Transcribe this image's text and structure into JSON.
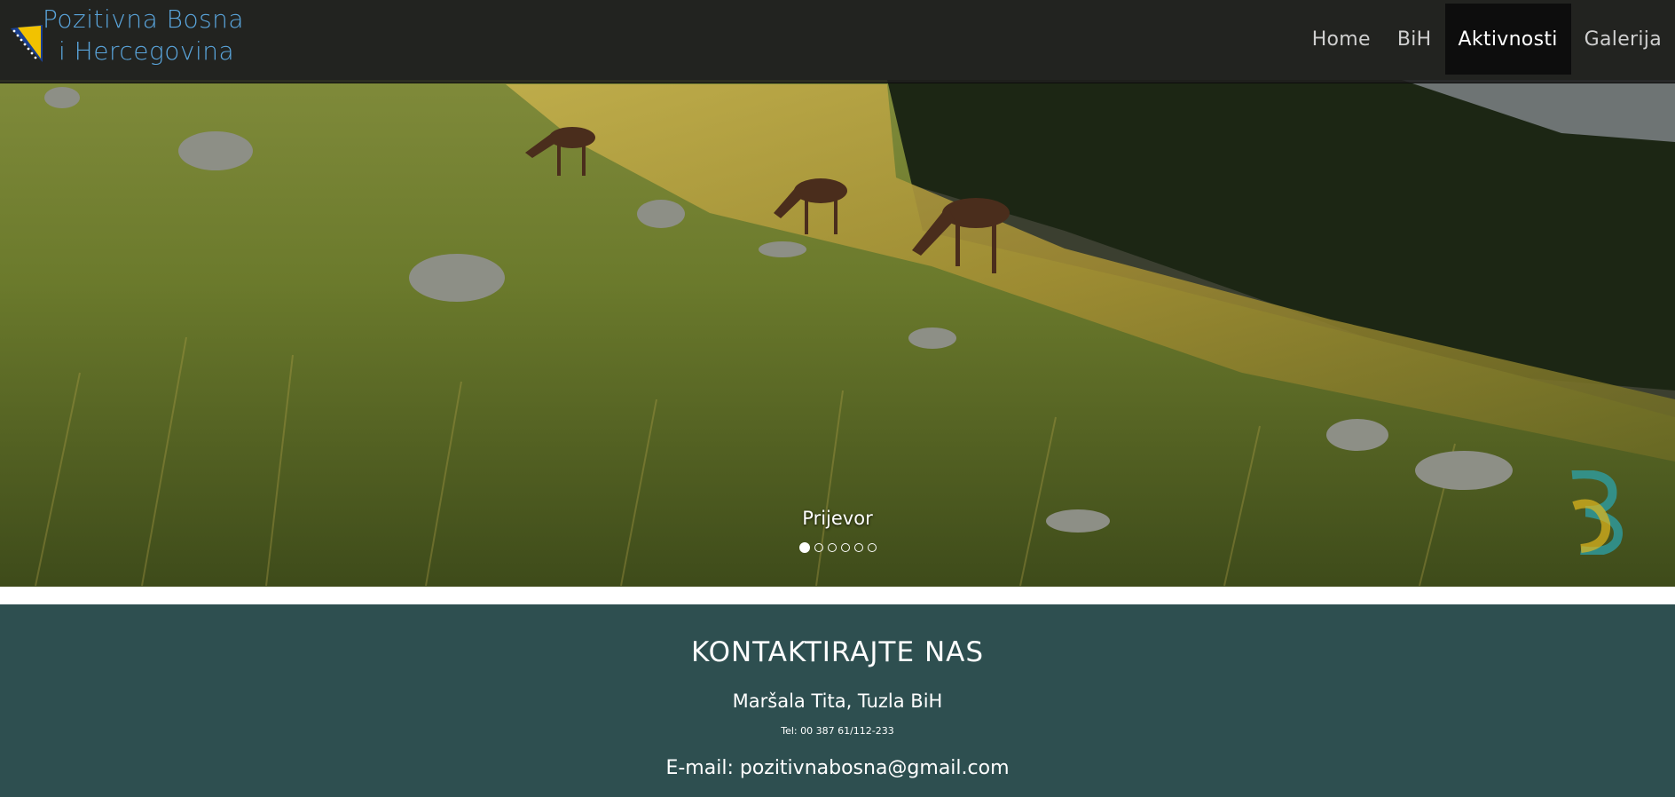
{
  "brand": {
    "line1": "Pozitivna Bosna",
    "line2": "i Hercegovina",
    "accent": "#5aa5dc"
  },
  "nav": {
    "items": [
      {
        "label": "Home"
      },
      {
        "label": "BiH"
      },
      {
        "label": "Aktivnosti",
        "active": true
      },
      {
        "label": "Galerija"
      }
    ]
  },
  "carousel": {
    "caption": "Prijevor",
    "slide_count": 6,
    "active_index": 0
  },
  "contact": {
    "title": "KONTAKTIRAJTE NAS",
    "address": "Maršala Tita, Tuzla BiH",
    "phone": "Tel: 00 387 61/112-233",
    "email": "E-mail: pozitivnabosna@gmail.com",
    "background": "#2e4f50"
  }
}
